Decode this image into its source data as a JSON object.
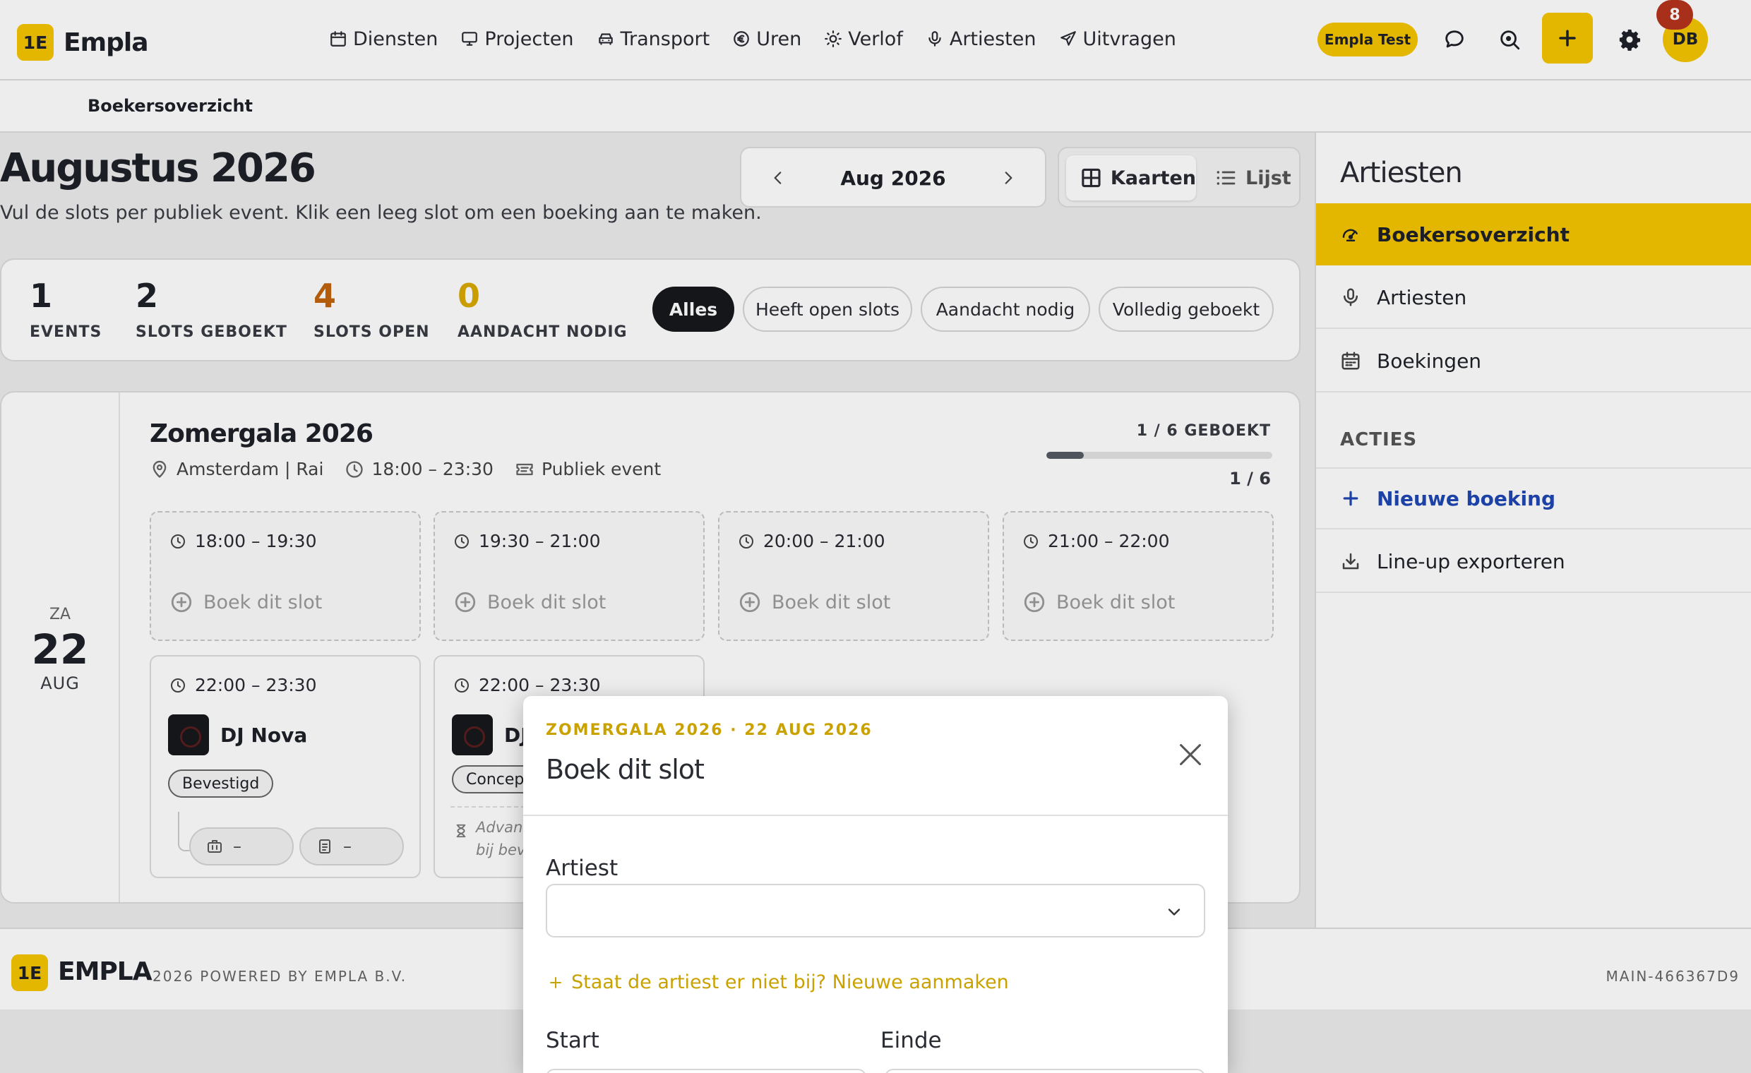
{
  "brand": {
    "logo": "1E",
    "name": "Empla"
  },
  "nav": [
    {
      "label": "Diensten",
      "icon": "calendar-icon"
    },
    {
      "label": "Projecten",
      "icon": "monitor-icon"
    },
    {
      "label": "Transport",
      "icon": "car-icon"
    },
    {
      "label": "Uren",
      "icon": "euro-icon"
    },
    {
      "label": "Verlof",
      "icon": "sun-icon"
    },
    {
      "label": "Artiesten",
      "icon": "microphone-icon"
    },
    {
      "label": "Uitvragen",
      "icon": "send-icon"
    }
  ],
  "topbar": {
    "tenant": "Empla Test",
    "avatar_initials": "DB",
    "notification_count": "8"
  },
  "breadcrumb": "Boekersoverzicht",
  "page": {
    "title": "Augustus 2026",
    "subtitle": "Vul de slots per publiek event. Klik een leeg slot om een boeking aan te maken.",
    "month_label": "Aug 2026",
    "view_cards": "Kaarten",
    "view_list": "Lijst"
  },
  "stats": [
    {
      "value": "1",
      "label": "EVENTS",
      "color": "#1f2128"
    },
    {
      "value": "2",
      "label": "SLOTS GEBOEKT",
      "color": "#1f2128"
    },
    {
      "value": "4",
      "label": "SLOTS OPEN",
      "color": "#c0630d"
    },
    {
      "value": "0",
      "label": "AANDACHT NODIG",
      "color": "#d9a800"
    }
  ],
  "filters": [
    "Alles",
    "Heeft open slots",
    "Aandacht nodig",
    "Volledig geboekt"
  ],
  "event": {
    "dow": "ZA",
    "day": "22",
    "month": "AUG",
    "title": "Zomergala 2026",
    "location": "Amsterdam | Rai",
    "time": "18:00 – 23:30",
    "type": "Publiek event",
    "booked_label": "1 / 6 GEBOEKT",
    "booked_fraction": 0.1667,
    "count": "1 / 6",
    "empty_slots": [
      {
        "time": "18:00 – 19:30",
        "cta": "Boek dit slot"
      },
      {
        "time": "19:30 – 21:00",
        "cta": "Boek dit slot"
      },
      {
        "time": "20:00 – 21:00",
        "cta": "Boek dit slot"
      },
      {
        "time": "21:00 – 22:00",
        "cta": "Boek dit slot"
      }
    ],
    "booked_slots": [
      {
        "time": "22:00 – 23:30",
        "artist": "DJ Nova",
        "status": "Bevestigd",
        "chip1": "–",
        "chip2": "–"
      },
      {
        "time": "22:00 – 23:30",
        "artist": "DJ",
        "status": "Concept",
        "note_line1": "Advanc",
        "note_line2": "bij beve"
      }
    ]
  },
  "sidebar": {
    "title": "Artiesten",
    "items": [
      {
        "label": "Boekersoverzicht",
        "icon": "dashboard-icon"
      },
      {
        "label": "Artiesten",
        "icon": "microphone-icon"
      },
      {
        "label": "Boekingen",
        "icon": "calendar-icon"
      }
    ],
    "section": "ACTIES",
    "actions": [
      {
        "label": "Nieuwe boeking",
        "icon": "plus-icon"
      },
      {
        "label": "Line-up exporteren",
        "icon": "download-icon"
      }
    ]
  },
  "footer": {
    "logo": "1E",
    "name": "EMPLA",
    "copyright": "2026 POWERED BY EMPLA B.V.",
    "version": "MAIN-466367D9"
  },
  "modal": {
    "overline": "ZOMERGALA 2026 · 22 AUG 2026",
    "title": "Boek dit slot",
    "artist_label": "Artiest",
    "artist_value": "",
    "create_link": "Staat de artiest er niet bij? Nieuwe aanmaken",
    "start_label": "Start",
    "end_label": "Einde"
  },
  "colors": {
    "accent": "#f5c400",
    "link": "#2047b4",
    "badge": "#b5341c"
  }
}
